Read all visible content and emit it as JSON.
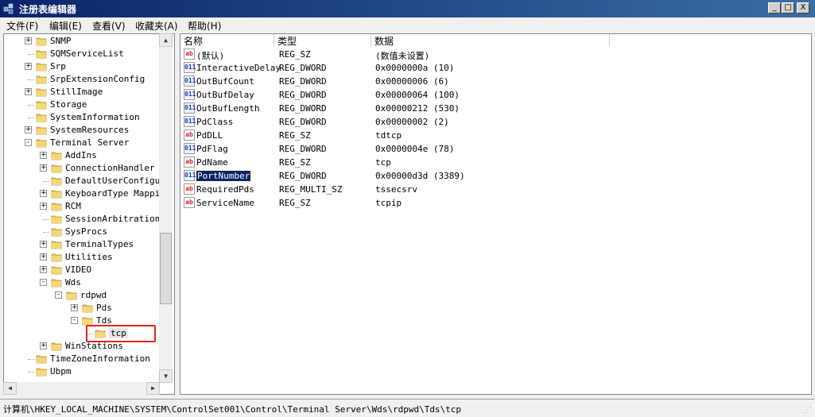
{
  "window": {
    "title": "注册表编辑器",
    "minimize": "_",
    "maximize": "□",
    "close": "X"
  },
  "menu": [
    "文件(F)",
    "编辑(E)",
    "查看(V)",
    "收藏夹(A)",
    "帮助(H)"
  ],
  "tree": {
    "items": [
      {
        "label": "SNMP",
        "expander": "+"
      },
      {
        "label": "SQMServiceList",
        "expander": ""
      },
      {
        "label": "Srp",
        "expander": "+"
      },
      {
        "label": "SrpExtensionConfig",
        "expander": ""
      },
      {
        "label": "StillImage",
        "expander": "+"
      },
      {
        "label": "Storage",
        "expander": ""
      },
      {
        "label": "SystemInformation",
        "expander": ""
      },
      {
        "label": "SystemResources",
        "expander": "+"
      },
      {
        "label": "Terminal Server",
        "expander": "-"
      },
      {
        "label": "AddIns",
        "expander": "+"
      },
      {
        "label": "ConnectionHandler",
        "expander": "+"
      },
      {
        "label": "DefaultUserConfigur",
        "expander": ""
      },
      {
        "label": "KeyboardType Mappin",
        "expander": "+"
      },
      {
        "label": "RCM",
        "expander": "+"
      },
      {
        "label": "SessionArbitrationH",
        "expander": ""
      },
      {
        "label": "SysProcs",
        "expander": ""
      },
      {
        "label": "TerminalTypes",
        "expander": "+"
      },
      {
        "label": "Utilities",
        "expander": "+"
      },
      {
        "label": "VIDEO",
        "expander": "+"
      },
      {
        "label": "Wds",
        "expander": "-"
      },
      {
        "label": "rdpwd",
        "expander": "-"
      },
      {
        "label": "Pds",
        "expander": "+"
      },
      {
        "label": "Tds",
        "expander": "-"
      },
      {
        "label": "tcp",
        "expander": ""
      },
      {
        "label": "WinStations",
        "expander": "+"
      },
      {
        "label": "TimeZoneInformation",
        "expander": ""
      },
      {
        "label": "Ubpm",
        "expander": ""
      }
    ],
    "highlight_color": "#e0271b"
  },
  "list": {
    "columns": [
      "名称",
      "类型",
      "数据"
    ],
    "rows": [
      {
        "icon": "ab",
        "name": "(默认)",
        "type": "REG_SZ",
        "data": "(数值未设置)"
      },
      {
        "icon": "011",
        "name": "InteractiveDelay",
        "type": "REG_DWORD",
        "data": "0x0000000a (10)"
      },
      {
        "icon": "011",
        "name": "OutBufCount",
        "type": "REG_DWORD",
        "data": "0x00000006 (6)"
      },
      {
        "icon": "011",
        "name": "OutBufDelay",
        "type": "REG_DWORD",
        "data": "0x00000064 (100)"
      },
      {
        "icon": "011",
        "name": "OutBufLength",
        "type": "REG_DWORD",
        "data": "0x00000212 (530)"
      },
      {
        "icon": "011",
        "name": "PdClass",
        "type": "REG_DWORD",
        "data": "0x00000002 (2)"
      },
      {
        "icon": "ab",
        "name": "PdDLL",
        "type": "REG_SZ",
        "data": "tdtcp"
      },
      {
        "icon": "011",
        "name": "PdFlag",
        "type": "REG_DWORD",
        "data": "0x0000004e (78)"
      },
      {
        "icon": "ab",
        "name": "PdName",
        "type": "REG_SZ",
        "data": "tcp"
      },
      {
        "icon": "011",
        "name": "PortNumber",
        "type": "REG_DWORD",
        "data": "0x00000d3d (3389)"
      },
      {
        "icon": "ab",
        "name": "RequiredPds",
        "type": "REG_MULTI_SZ",
        "data": "tssecsrv"
      },
      {
        "icon": "ab",
        "name": "ServiceName",
        "type": "REG_SZ",
        "data": "tcpip"
      }
    ]
  },
  "status": {
    "path": "计算机\\HKEY_LOCAL_MACHINE\\SYSTEM\\ControlSet001\\Control\\Terminal Server\\Wds\\rdpwd\\Tds\\tcp"
  }
}
